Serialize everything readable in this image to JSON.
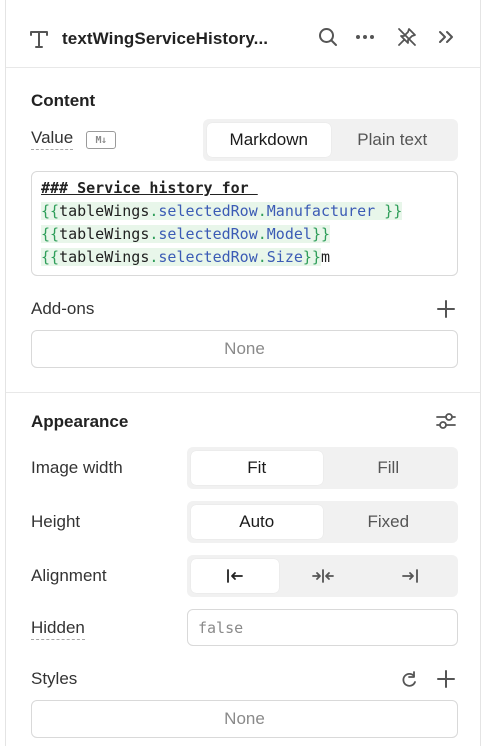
{
  "header": {
    "title": "textWingServiceHistory...",
    "type_icon": "text-type-icon",
    "actions": [
      "search-icon",
      "more-icon",
      "unpin-icon",
      "collapse-icon"
    ]
  },
  "content": {
    "section_title": "Content",
    "value_label": "Value",
    "markdown_badge": "M↓",
    "mode_options": [
      "Markdown",
      "Plain text"
    ],
    "mode_selected": "Markdown",
    "code_lines": {
      "heading": "### Service history for ",
      "l2_open": "{{",
      "l2_obj": "tableWings",
      "l2_dot1": ".",
      "l2_prop1": "selectedRow",
      "l2_dot2": ".",
      "l2_prop2": "Manufacturer",
      "l2_close": " }}",
      "l3_open": "{{",
      "l3_obj": "tableWings",
      "l3_dot1": ".",
      "l3_prop1": "selectedRow",
      "l3_dot2": ".",
      "l3_prop2": "Model",
      "l3_close": "}}",
      "l4_open": "{{",
      "l4_obj": "tableWings",
      "l4_dot1": ".",
      "l4_prop1": "selectedRow",
      "l4_dot2": ".",
      "l4_prop2": "Size",
      "l4_close": "}}",
      "l4_tail": "m"
    },
    "addons_label": "Add-ons",
    "addons_value": "None"
  },
  "appearance": {
    "section_title": "Appearance",
    "image_width_label": "Image width",
    "image_width_options": [
      "Fit",
      "Fill"
    ],
    "image_width_selected": "Fit",
    "height_label": "Height",
    "height_options": [
      "Auto",
      "Fixed"
    ],
    "height_selected": "Auto",
    "alignment_label": "Alignment",
    "alignment_options": [
      "align-left-icon",
      "align-center-icon",
      "align-right-icon"
    ],
    "alignment_selected": "align-left-icon",
    "hidden_label": "Hidden",
    "hidden_placeholder": "false",
    "styles_label": "Styles",
    "styles_value": "None"
  },
  "colors": {
    "template_bg": "#e8f6ea",
    "brace": "#2f9e5a",
    "property": "#3b5bb5",
    "segment_bg": "#f1f1f1"
  }
}
